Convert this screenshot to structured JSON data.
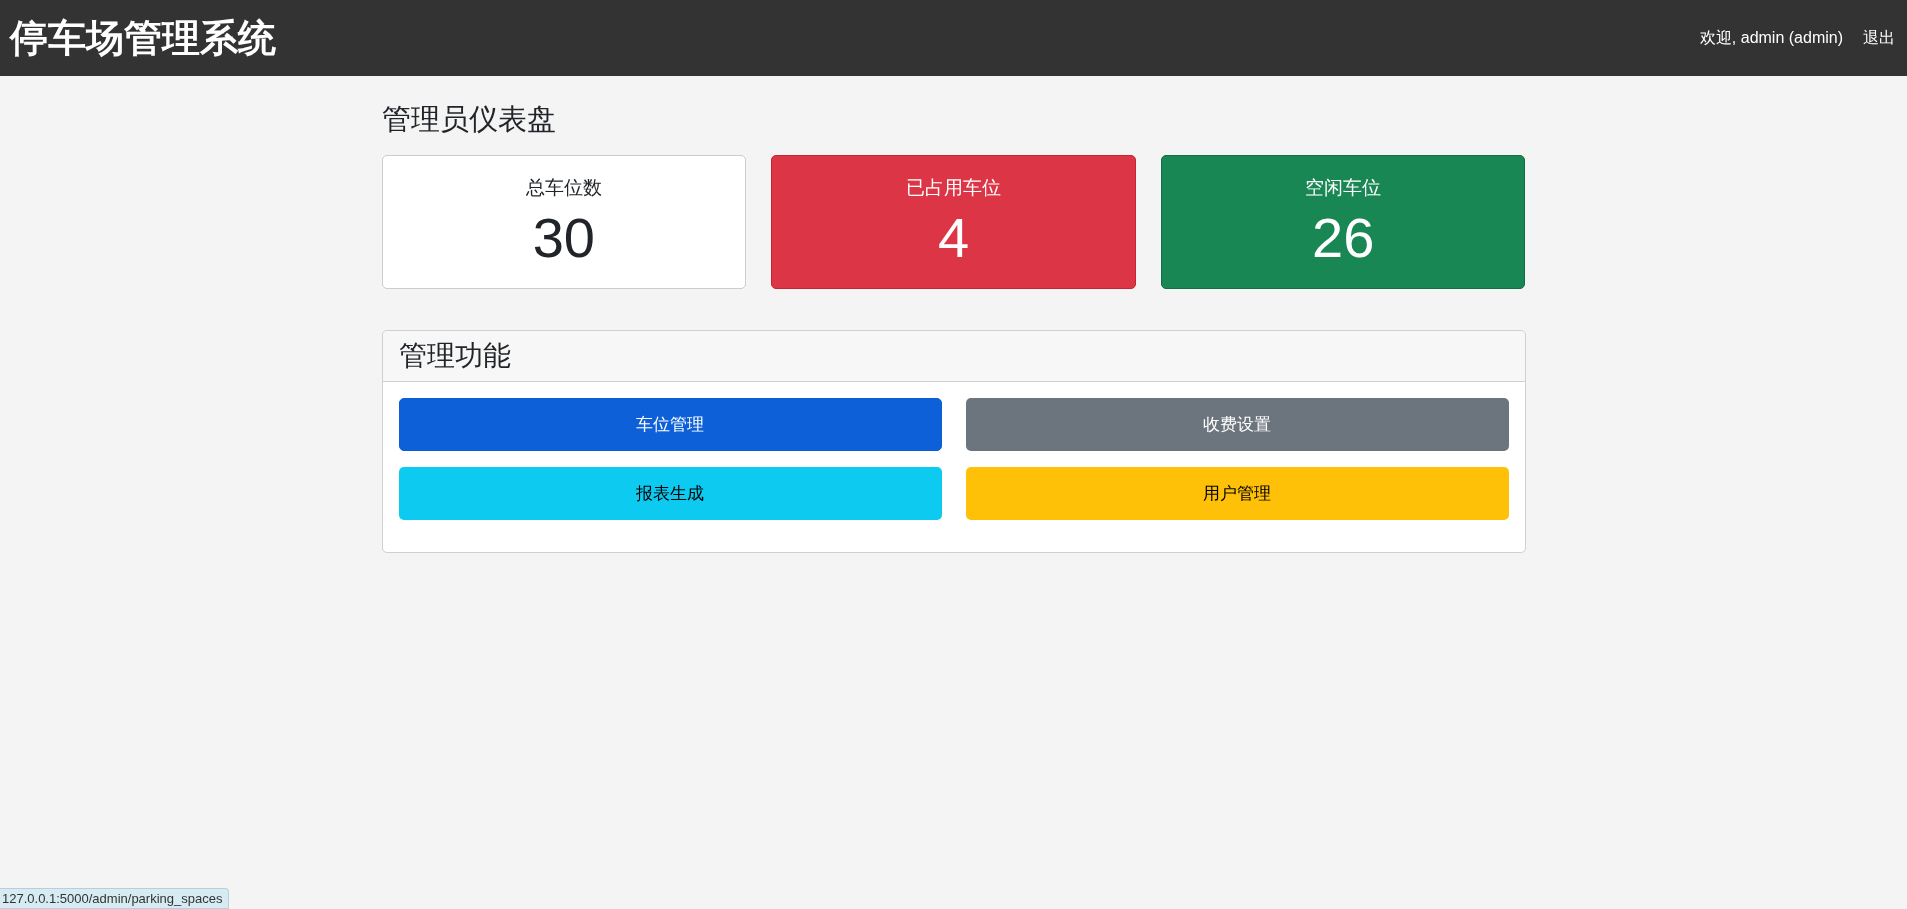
{
  "header": {
    "title": "停车场管理系统",
    "welcome": "欢迎, admin (admin)",
    "logout": "退出"
  },
  "page_title": "管理员仪表盘",
  "stats": [
    {
      "label": "总车位数",
      "value": "30",
      "kind": "plain"
    },
    {
      "label": "已占用车位",
      "value": "4",
      "kind": "danger"
    },
    {
      "label": "空闲车位",
      "value": "26",
      "kind": "success"
    }
  ],
  "admin_panel": {
    "title": "管理功能",
    "buttons": [
      {
        "label": "车位管理",
        "kind": "primary"
      },
      {
        "label": "收费设置",
        "kind": "secondary"
      },
      {
        "label": "报表生成",
        "kind": "info"
      },
      {
        "label": "用户管理",
        "kind": "warning"
      }
    ]
  },
  "status_bar": {
    "url": "127.0.0.1:5000/admin/parking_spaces"
  }
}
